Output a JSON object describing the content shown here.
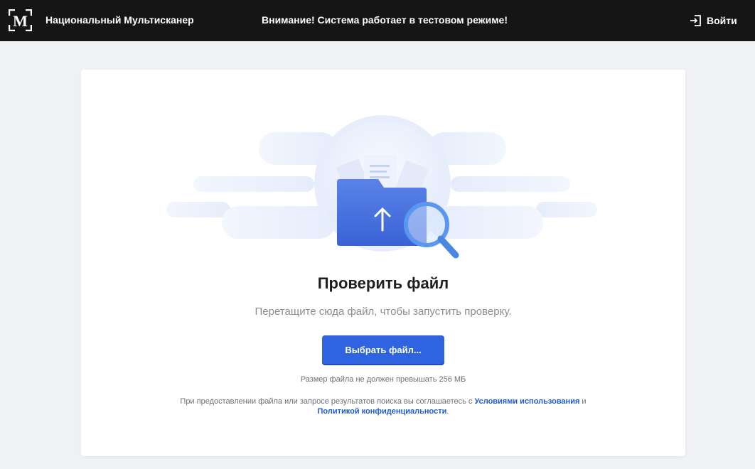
{
  "header": {
    "logo_letter": "M",
    "brand": "Национальный Мультисканер",
    "notice": "Внимание! Система работает в тестовом режиме!",
    "login_label": "Войти",
    "login_icon": "login-icon"
  },
  "upload": {
    "illustration_icon": "folder-upload-search-icon",
    "title": "Проверить файл",
    "subtitle": "Перетащите сюда файл, чтобы запустить проверку.",
    "choose_button": "Выбрать файл...",
    "size_limit": "Размер файла не должен превышать 256 МБ",
    "terms_before": "При предоставлении файла или запросе результатов поиска вы соглашаетесь с ",
    "terms_link": "Условиями использования",
    "terms_and": " и",
    "privacy_link": "Политикой конфиденциальности",
    "terms_end": "."
  },
  "colors": {
    "header_bg": "#151515",
    "page_bg": "#eff1f5",
    "accent": "#2f63e0",
    "link": "#1e5bd6"
  }
}
